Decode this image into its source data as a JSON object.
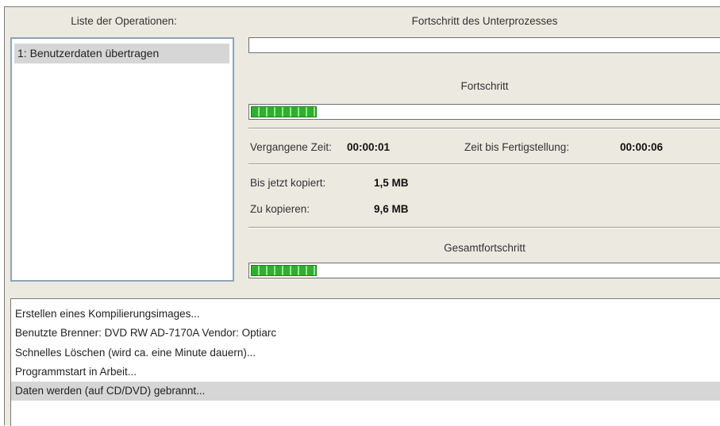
{
  "headers": {
    "operations_list": "Liste der Operationen:",
    "subprocess_progress": "Fortschritt des Unterprozesses"
  },
  "operations": {
    "items": [
      {
        "label": "1: Benutzerdaten übertragen",
        "selected": true
      }
    ]
  },
  "progress": {
    "subprocess_value": 0,
    "progress_label": "Fortschritt",
    "progress_value": 0.14,
    "elapsed_label": "Vergangene Zeit:",
    "elapsed_value": "00:00:01",
    "remaining_label": "Zeit bis Fertigstellung:",
    "remaining_value": "00:00:06",
    "copied_label": "Bis jetzt kopiert:",
    "copied_value": "1,5 MB",
    "to_copy_label": "Zu kopieren:",
    "to_copy_value": "9,6 MB",
    "total_label": "Gesamtfortschritt",
    "total_value": 0.14
  },
  "log": {
    "lines": [
      "Erstellen eines Kompilierungsimages...",
      "Benutzte Brenner: DVD RW AD-7170A   Vendor: Optiarc",
      "Schnelles Löschen  (wird ca. eine Minute dauern)...",
      "Programmstart in Arbeit...",
      "Daten werden (auf CD/DVD) gebrannt..."
    ],
    "selected_index": 4
  },
  "colors": {
    "panel_bg": "#ece9e0",
    "progress_green": "#2fae2f",
    "selection_gray": "#d6d6d6",
    "list_border": "#8fa3b8"
  }
}
